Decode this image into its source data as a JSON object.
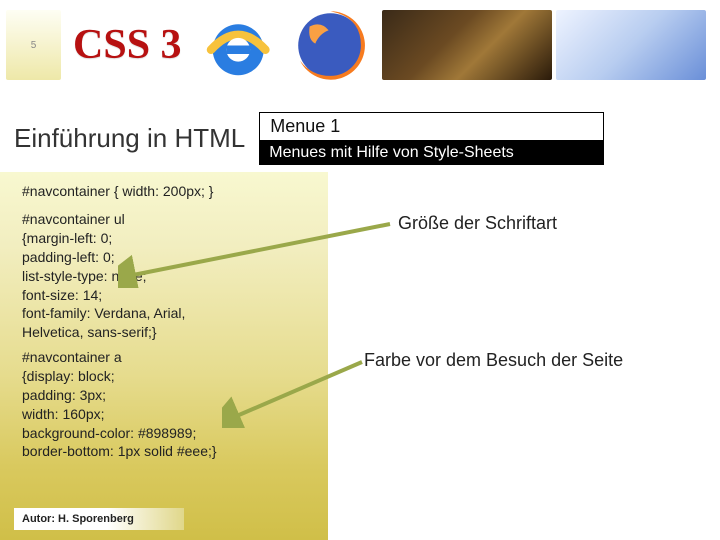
{
  "header": {
    "logo_left_text": "5",
    "css_word": "CSS 3"
  },
  "title": "Einführung in HTML",
  "subtitle_top": "Menue 1",
  "subtitle_bottom": "Menues mit Hilfe von Style-Sheets",
  "code": {
    "block1": "#navcontainer { width: 200px; }",
    "block2": "#navcontainer ul\n{margin-left: 0;\npadding-left: 0;\nlist-style-type: none;\nfont-size: 14;\nfont-family: Verdana, Arial,\nHelvetica, sans-serif;}",
    "block3": "#navcontainer a\n{display: block;\npadding: 3px;\nwidth: 160px;\nbackground-color: #898989;\nborder-bottom: 1px solid #eee;}"
  },
  "annotations": {
    "font_size": "Größe der Schriftart",
    "color_before_visit": "Farbe vor dem Besuch der Seite"
  },
  "author": "Autor: H. Sporenberg",
  "colors": {
    "arrow": "#9aa84a",
    "black_bar": "#000000",
    "css_word": "#b71111"
  }
}
